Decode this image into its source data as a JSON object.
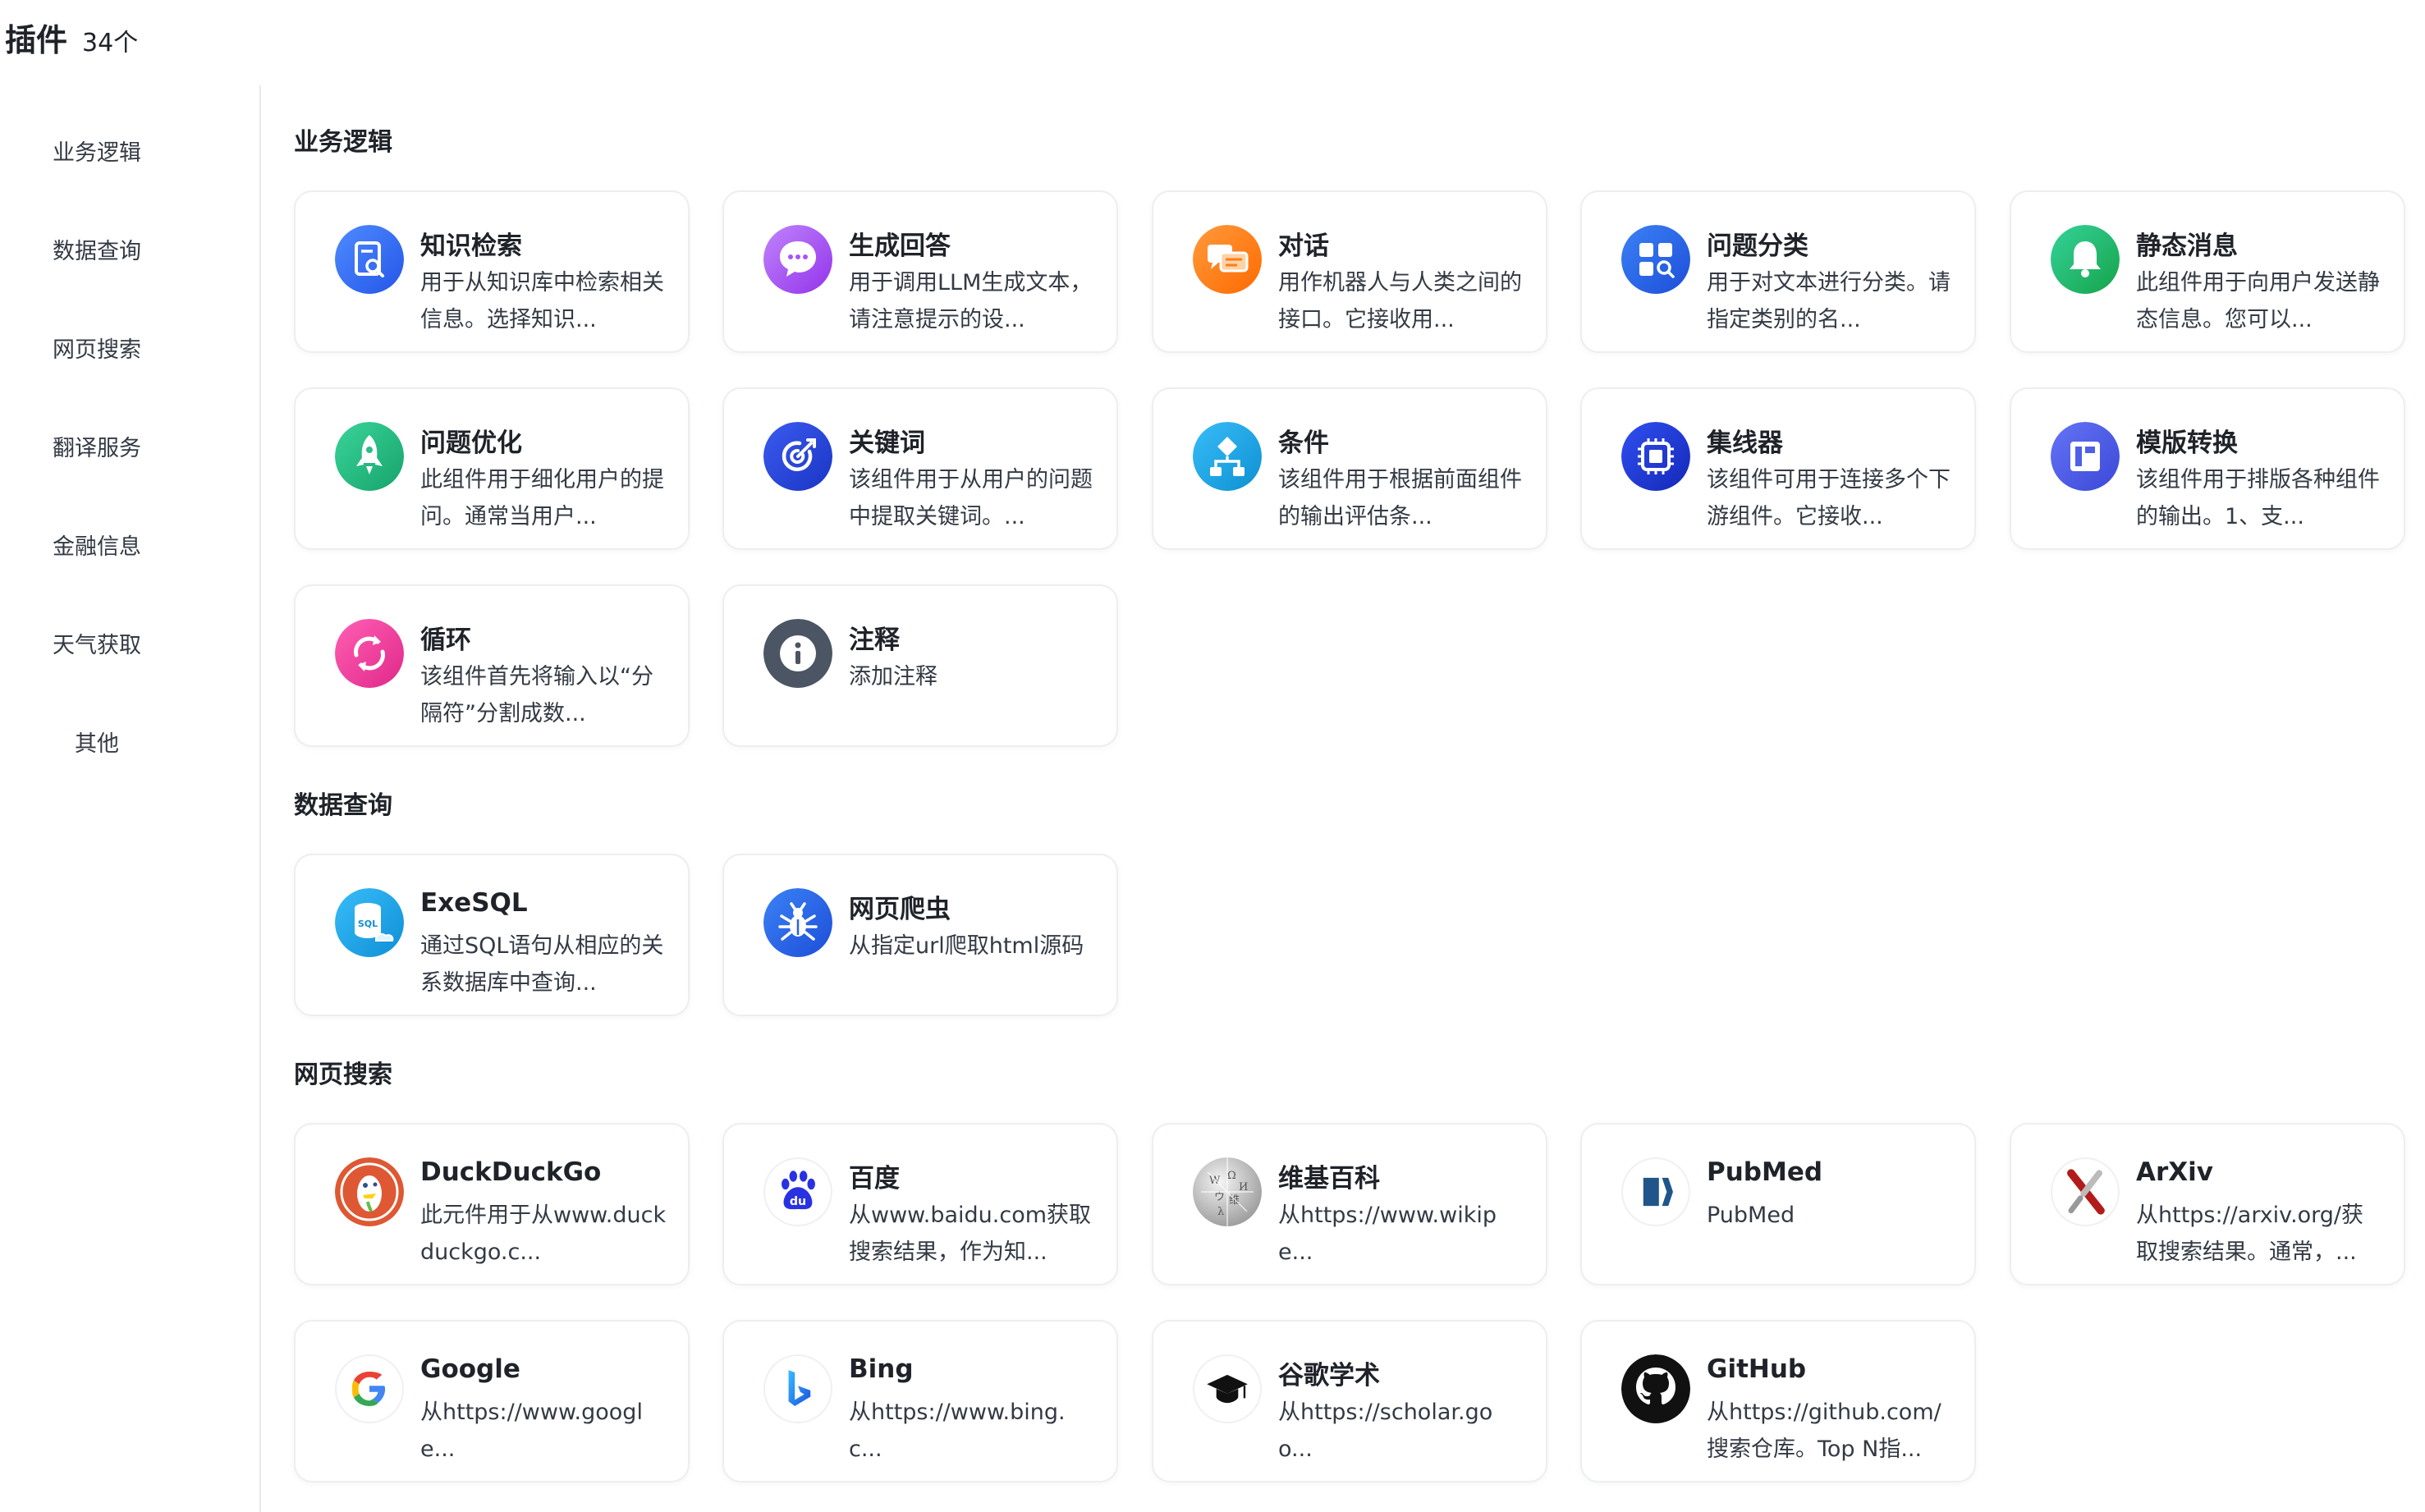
{
  "header": {
    "title": "插件",
    "count": "34个"
  },
  "sidebar": {
    "items": [
      {
        "label": "业务逻辑"
      },
      {
        "label": "数据查询"
      },
      {
        "label": "网页搜索"
      },
      {
        "label": "翻译服务"
      },
      {
        "label": "金融信息"
      },
      {
        "label": "天气获取"
      },
      {
        "label": "其他"
      }
    ]
  },
  "sections": [
    {
      "title": "业务逻辑",
      "cards": [
        {
          "name": "知识检索",
          "desc": "用于从知识库中检索相关信息。选择知识...",
          "icon": "knowledge-search-icon",
          "color": "#3370ff"
        },
        {
          "name": "生成回答",
          "desc": "用于调用LLM生成文本，请注意提示的设...",
          "icon": "chat-bubble-icon",
          "color": "#a855f7"
        },
        {
          "name": "对话",
          "desc": "用作机器人与人类之间的接口。它接收用...",
          "icon": "conversation-icon",
          "color": "#ff7d1a"
        },
        {
          "name": "问题分类",
          "desc": "用于对文本进行分类。请指定类别的名...",
          "icon": "category-icon",
          "color": "#2563eb"
        },
        {
          "name": "静态消息",
          "desc": "此组件用于向用户发送静态信息。您可以...",
          "icon": "bell-icon",
          "color": "#22c55e"
        },
        {
          "name": "问题优化",
          "desc": "此组件用于细化用户的提问。通常当用户...",
          "icon": "rocket-icon",
          "color": "#2dbd85"
        },
        {
          "name": "关键词",
          "desc": "该组件用于从用户的问题中提取关键词。...",
          "icon": "target-icon",
          "color": "#2447d6"
        },
        {
          "name": "条件",
          "desc": "该组件用于根据前面组件的输出评估条...",
          "icon": "branch-icon",
          "color": "#1aa6e6"
        },
        {
          "name": "集线器",
          "desc": "该组件可用于连接多个下游组件。它接收...",
          "icon": "chip-icon",
          "color": "#1d3fd8"
        },
        {
          "name": "模版转换",
          "desc": "该组件用于排版各种组件的输出。1、支...",
          "icon": "template-icon",
          "color": "#4f5fe8"
        },
        {
          "name": "循环",
          "desc": "该组件首先将输入以“分隔符”分割成数...",
          "icon": "loop-icon",
          "color": "#f0479c"
        },
        {
          "name": "注释",
          "desc": "添加注释",
          "icon": "info-icon",
          "color": "#4b5563"
        }
      ]
    },
    {
      "title": "数据查询",
      "cards": [
        {
          "name": "ExeSQL",
          "desc": "通过SQL语句从相应的关系数据库中查询...",
          "icon": "sql-database-icon",
          "color": "#1aa6e6"
        },
        {
          "name": "网页爬虫",
          "desc": "从指定url爬取html源码",
          "icon": "spider-icon",
          "color": "#2563eb"
        }
      ]
    },
    {
      "title": "网页搜索",
      "cards": [
        {
          "name": "DuckDuckGo",
          "desc": "此元件用于从www.duckduckgo.c...",
          "icon": "duckduckgo-icon",
          "color": "#de5833"
        },
        {
          "name": "百度",
          "desc": "从www.baidu.com获取搜索结果，作为知...",
          "icon": "baidu-icon",
          "color": "#2932e1"
        },
        {
          "name": "维基百科",
          "desc": "从https://www.wikipe...",
          "icon": "wikipedia-icon",
          "color": "#888888"
        },
        {
          "name": "PubMed",
          "desc": "PubMed",
          "icon": "pubmed-icon",
          "color": "#20558a"
        },
        {
          "name": "ArXiv",
          "desc": "从https://arxiv.org/获取搜索结果。通常，...",
          "icon": "arxiv-icon",
          "color": "#b31b1b"
        },
        {
          "name": "Google",
          "desc": "从https://www.google...",
          "icon": "google-icon",
          "color": "#4285f4"
        },
        {
          "name": "Bing",
          "desc": "从https://www.bing.c...",
          "icon": "bing-icon",
          "color": "#1b6ee8"
        },
        {
          "name": "谷歌学术",
          "desc": "从https://scholar.goo...",
          "icon": "scholar-cap-icon",
          "color": "#111111"
        },
        {
          "name": "GitHub",
          "desc": "从https://github.com/搜索仓库。Top N指...",
          "icon": "github-icon",
          "color": "#111111"
        }
      ]
    }
  ]
}
